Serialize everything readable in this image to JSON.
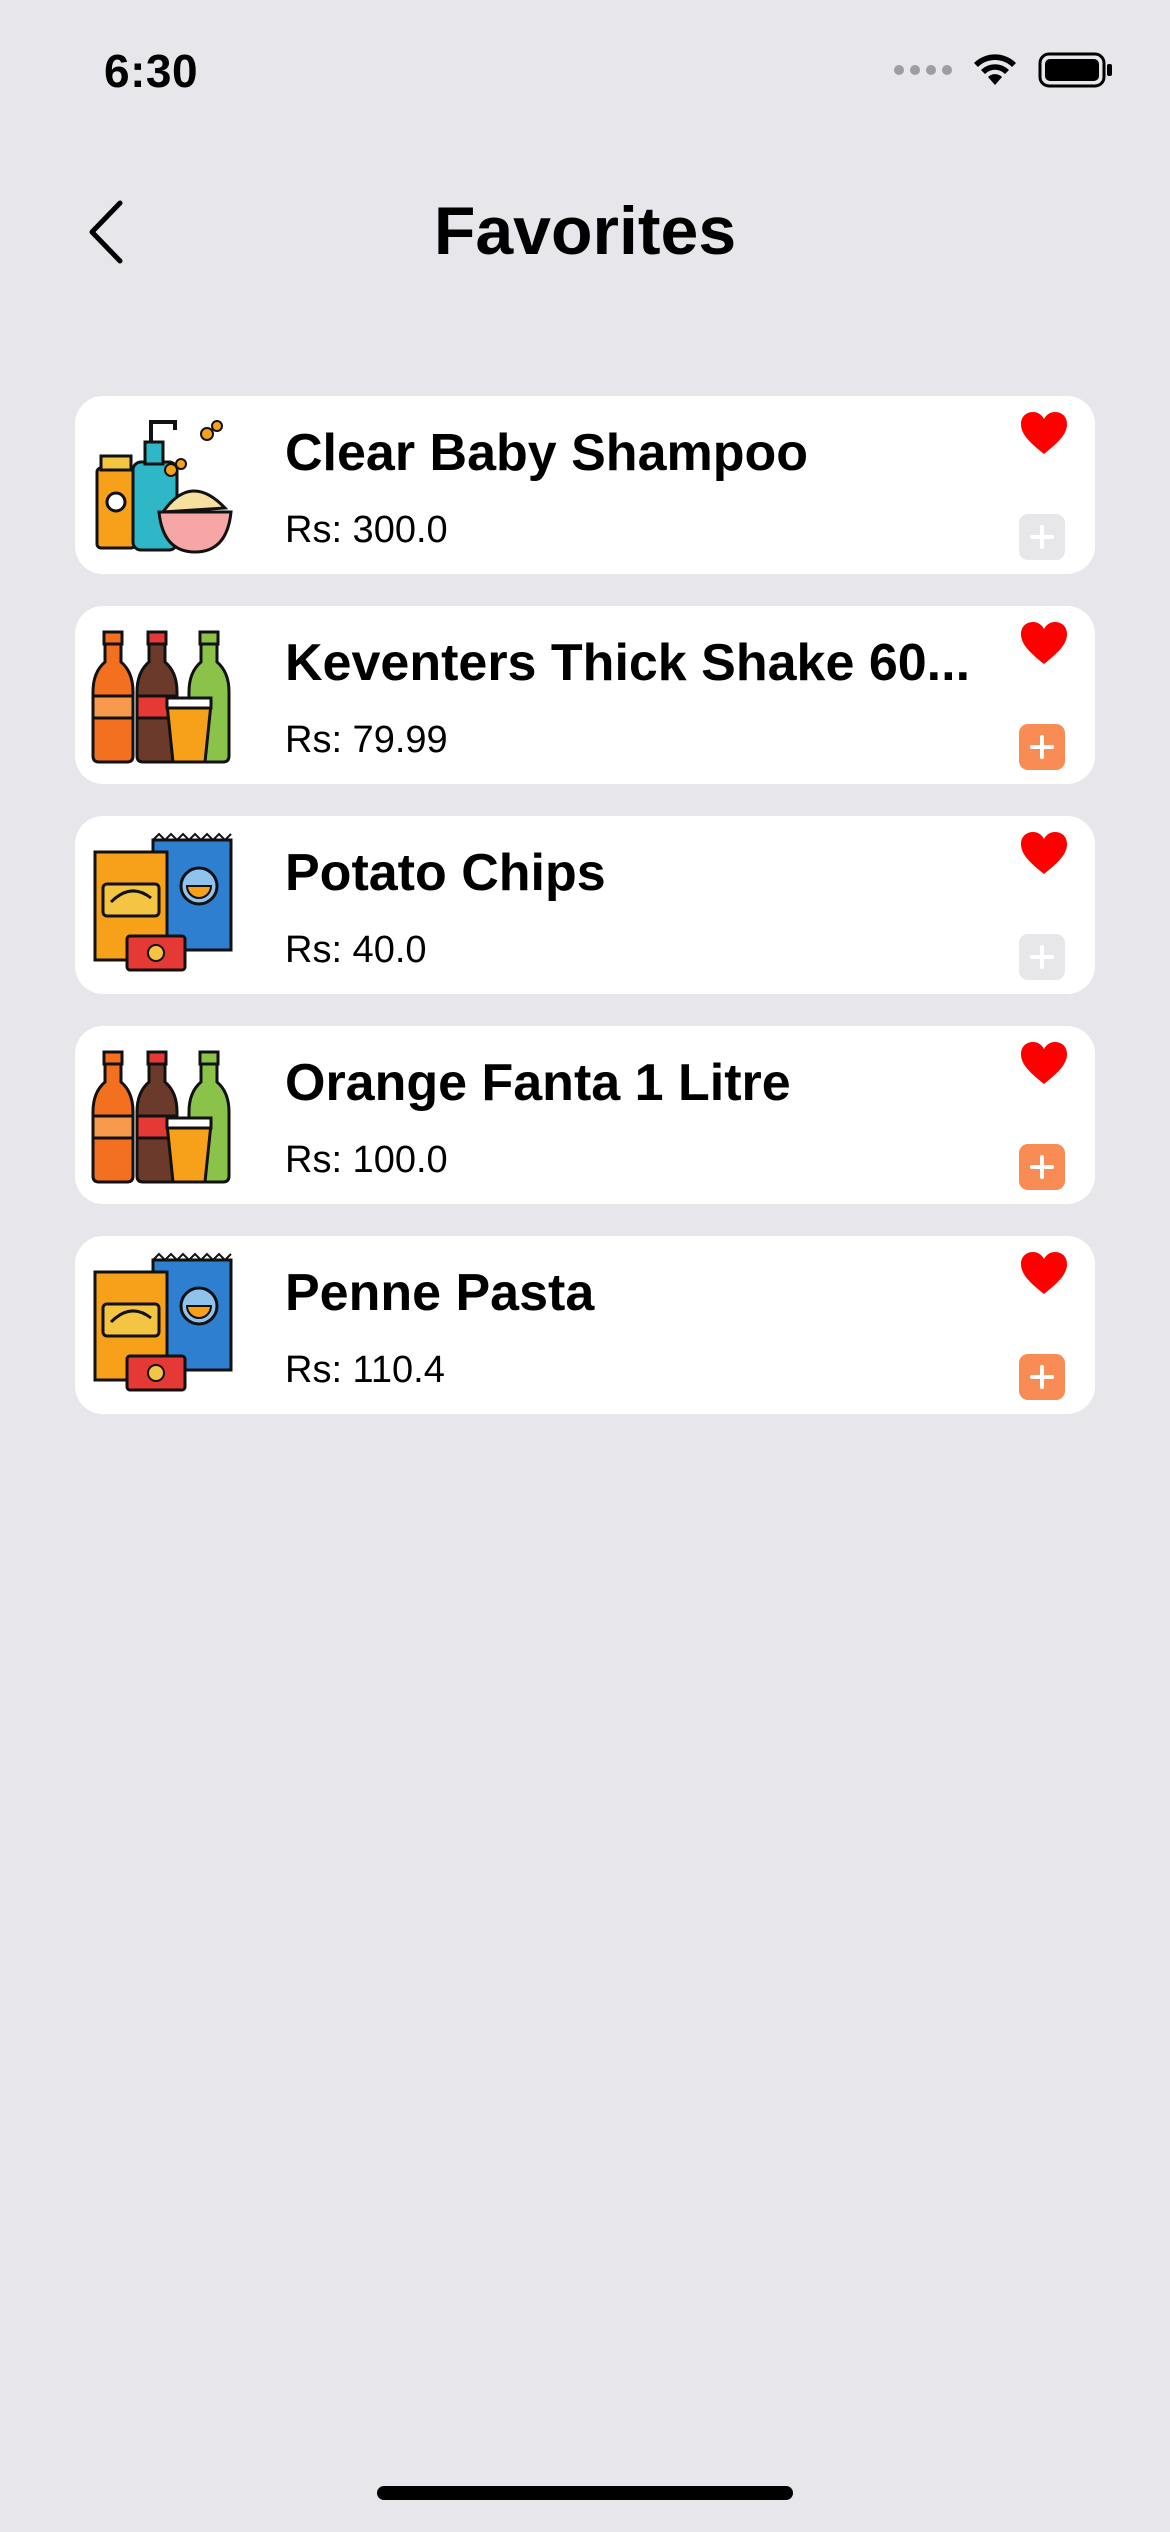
{
  "status_bar": {
    "time": "6:30"
  },
  "nav": {
    "title": "Favorites",
    "back_icon": "chevron-left-icon"
  },
  "colors": {
    "background": "#e6e6eb",
    "heart": "#ff0000",
    "add_enabled": "#f98c55",
    "add_disabled": "#e7e7ea"
  },
  "items": [
    {
      "name": "Clear Baby Shampoo",
      "price": "Rs: 300.0",
      "image": "baby-care-icon",
      "add_enabled": false
    },
    {
      "name": "Keventers Thick Shake 60...",
      "price": "Rs: 79.99",
      "image": "beverages-icon",
      "add_enabled": true
    },
    {
      "name": "Potato Chips",
      "price": "Rs: 40.0",
      "image": "snacks-icon",
      "add_enabled": false
    },
    {
      "name": "Orange Fanta 1 Litre",
      "price": "Rs: 100.0",
      "image": "beverages-icon",
      "add_enabled": true
    },
    {
      "name": "Penne Pasta",
      "price": "Rs: 110.4",
      "image": "snacks-icon",
      "add_enabled": true
    }
  ]
}
